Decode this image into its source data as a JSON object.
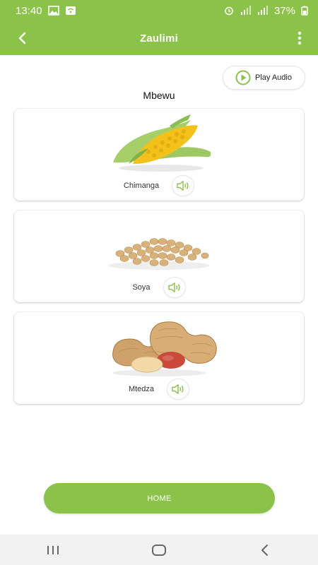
{
  "status_bar": {
    "time": "13:40",
    "battery": "37%",
    "icons_left": [
      "image-icon",
      "wallet-icon"
    ],
    "icons_right": [
      "alarm-icon",
      "signal-icon",
      "signal-icon",
      "battery-icon"
    ]
  },
  "app_bar": {
    "title": "Zaulimi",
    "back_icon": "arrow-left-icon",
    "menu_icon": "more-vertical-icon"
  },
  "play_audio": {
    "label": "Play Audio",
    "icon": "play-circle-icon"
  },
  "section": {
    "title": "Mbewu"
  },
  "items": [
    {
      "name": "Chimanga",
      "image": "corn",
      "audio_icon": "speaker-icon"
    },
    {
      "name": "Soya",
      "image": "soybeans",
      "audio_icon": "speaker-icon"
    },
    {
      "name": "Mtedza",
      "image": "peanuts",
      "audio_icon": "speaker-icon"
    }
  ],
  "home_button": {
    "label": "HOME"
  },
  "colors": {
    "accent": "#8bc34a",
    "background": "#ffffff",
    "nav_bar": "#f2f2f2"
  }
}
